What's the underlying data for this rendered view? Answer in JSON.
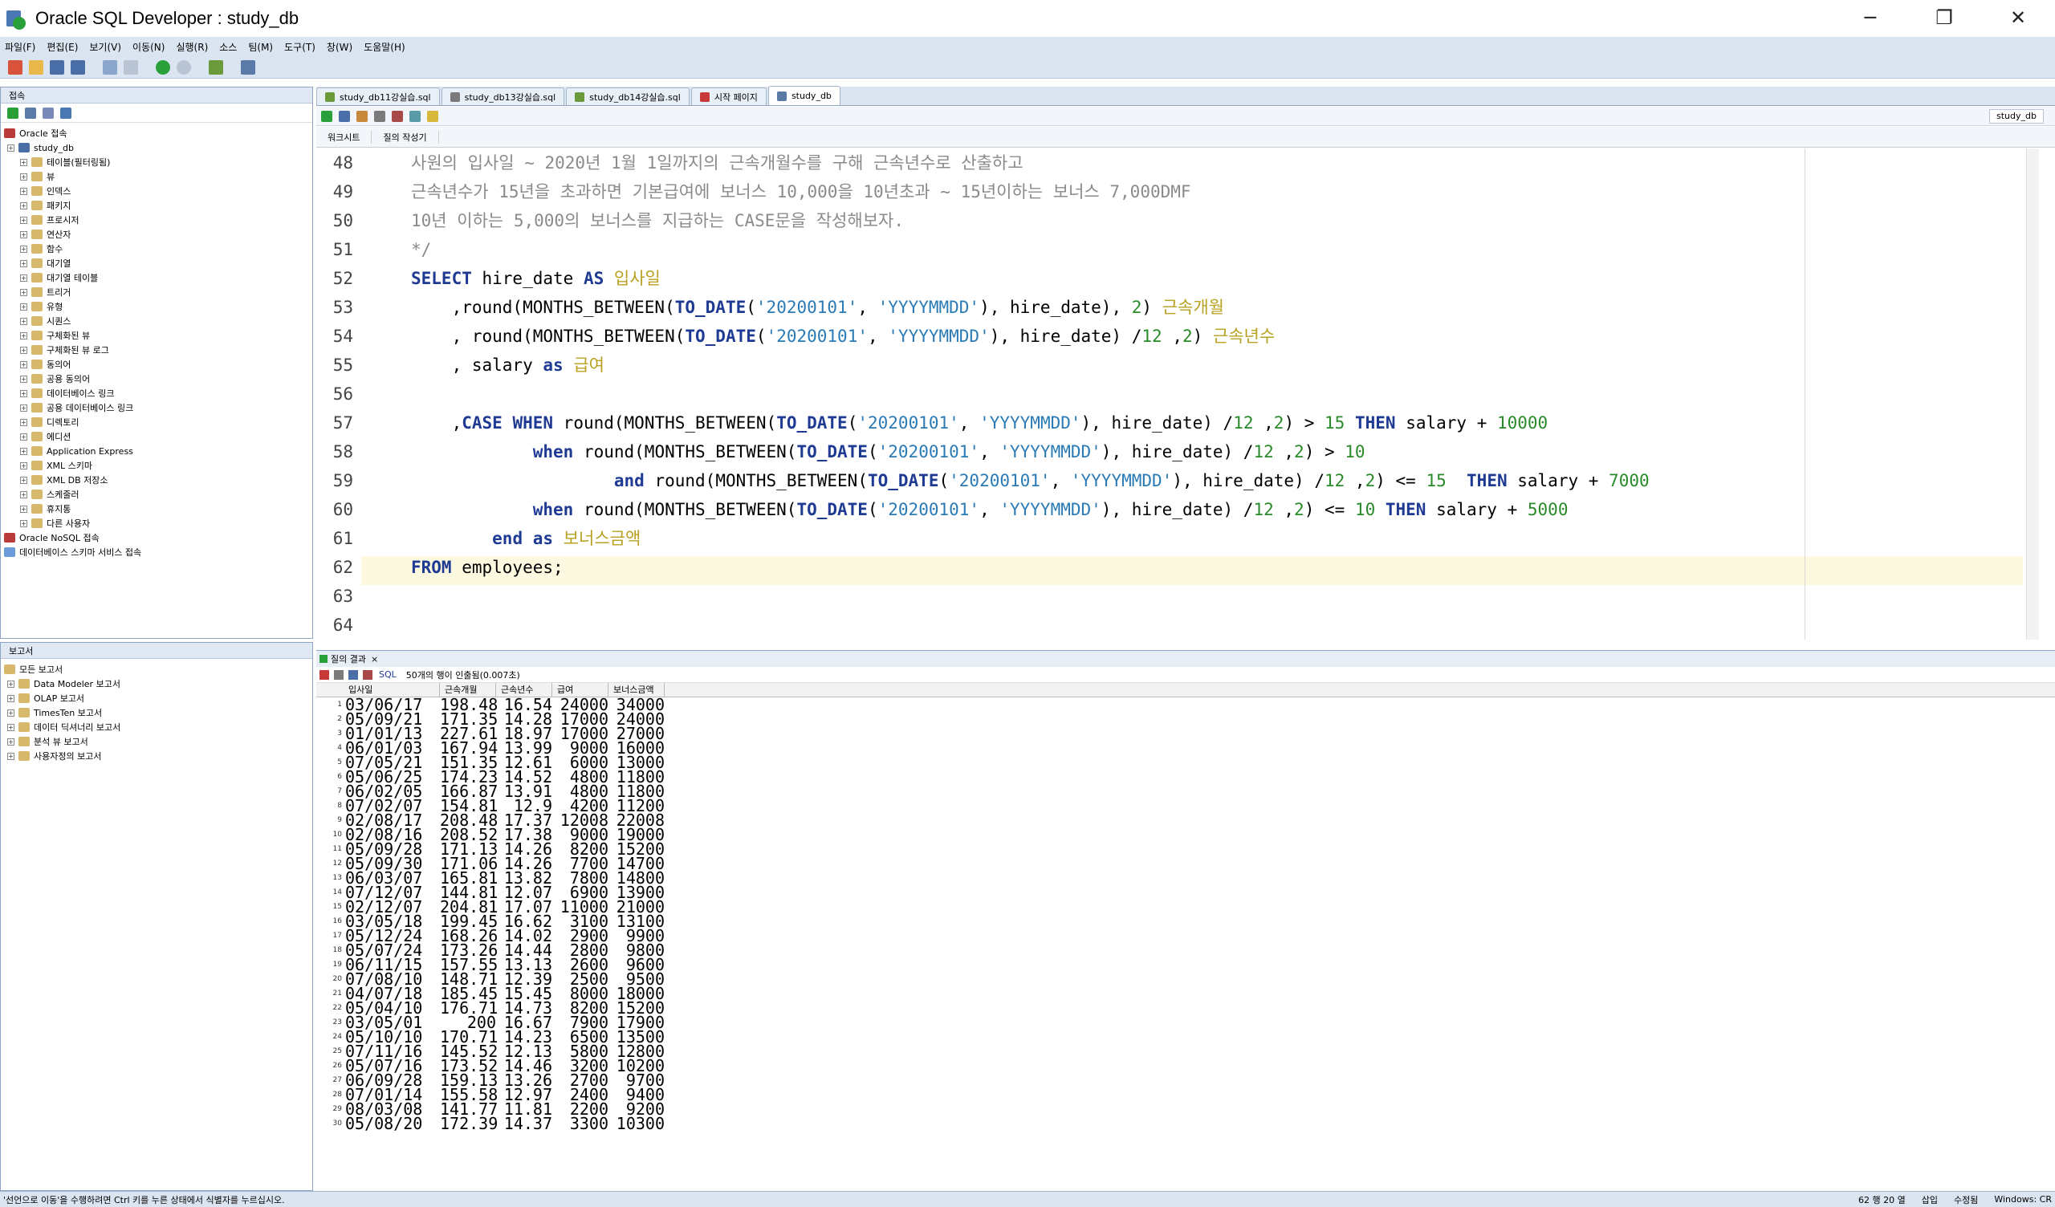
{
  "window": {
    "title": "Oracle SQL Developer : study_db",
    "minimize": "─",
    "maximize": "❐",
    "close": "✕"
  },
  "menu": [
    "파일(F)",
    "편집(E)",
    "보기(V)",
    "이동(N)",
    "실행(R)",
    "소스",
    "팀(M)",
    "도구(T)",
    "창(W)",
    "도움말(H)"
  ],
  "connections": {
    "header": "접속",
    "oracle_label": "Oracle 접속",
    "db_label": "study_db",
    "items": [
      "테이블(필터링됨)",
      "뷰",
      "인덱스",
      "패키지",
      "프로시저",
      "연산자",
      "함수",
      "대기열",
      "대기열 테이블",
      "트리거",
      "유형",
      "시퀀스",
      "구체화된 뷰",
      "구체화된 뷰 로그",
      "동의어",
      "공용 동의어",
      "데이터베이스 링크",
      "공용 데이터베이스 링크",
      "디렉토리",
      "에디션",
      "Application Express",
      "XML 스키마",
      "XML DB 저장소",
      "스케줄러",
      "휴지통",
      "다른 사용자"
    ],
    "nosql_label": "Oracle NoSQL 접속",
    "cloud_label": "데이터베이스 스키마 서비스 접속"
  },
  "reports": {
    "header": "보고서",
    "items": [
      "모든 보고서",
      "Data Modeler 보고서",
      "OLAP 보고서",
      "TimesTen 보고서",
      "데이터 딕셔너리 보고서",
      "분석 뷰 보고서",
      "사용자정의 보고서"
    ]
  },
  "editor_tabs": [
    "study_db11강실습.sql",
    "study_db13강실습.sql",
    "study_db14강실습.sql",
    "시작 페이지",
    "study_db"
  ],
  "connection_selector": "study_db",
  "sub_tabs": [
    "워크시트",
    "질의 작성기"
  ],
  "code_lines": [
    {
      "n": "48",
      "html": "<span class='cm'>사원의 입사일 ~ 2020년 1월 1일까지의 근속개월수를 구해 근속년수로 산출하고</span>"
    },
    {
      "n": "49",
      "html": "<span class='cm'>근속년수가 15년을 초과하면 기본급여에 보너스 10,000을 10년초과 ~ 15년이하는 보너스 7,000DMF</span>"
    },
    {
      "n": "50",
      "html": "<span class='cm'>10년 이하는 5,000의 보너스를 지급하는 CASE문을 작성해보자.</span>"
    },
    {
      "n": "51",
      "html": "<span class='cm'>*/</span>"
    },
    {
      "n": "52",
      "html": "<span class='kw'>SELECT</span> hire_date <span class='kw'>AS</span> <span class='al'>입사일</span>"
    },
    {
      "n": "53",
      "html": "    ,round(MONTHS_BETWEEN(<span class='kw'>TO_DATE</span>(<span class='str'>'20200101'</span>, <span class='str'>'YYYYMMDD'</span>), hire_date), <span class='num'>2</span>) <span class='al'>근속개월</span>"
    },
    {
      "n": "54",
      "html": "    , round(MONTHS_BETWEEN(<span class='kw'>TO_DATE</span>(<span class='str'>'20200101'</span>, <span class='str'>'YYYYMMDD'</span>), hire_date) /<span class='num'>12</span> ,<span class='num'>2</span>) <span class='al'>근속년수</span>"
    },
    {
      "n": "55",
      "html": "    , salary <span class='kw'>as</span> <span class='al'>급여</span>"
    },
    {
      "n": "56",
      "html": ""
    },
    {
      "n": "57",
      "html": "    ,<span class='kw'>CASE</span> <span class='kw'>WHEN</span> round(MONTHS_BETWEEN(<span class='kw'>TO_DATE</span>(<span class='str'>'20200101'</span>, <span class='str'>'YYYYMMDD'</span>), hire_date) /<span class='num'>12</span> ,<span class='num'>2</span>) > <span class='num'>15</span> <span class='kw'>THEN</span> salary + <span class='num'>10000</span>"
    },
    {
      "n": "58",
      "html": "            <span class='kw'>when</span> round(MONTHS_BETWEEN(<span class='kw'>TO_DATE</span>(<span class='str'>'20200101'</span>, <span class='str'>'YYYYMMDD'</span>), hire_date) /<span class='num'>12</span> ,<span class='num'>2</span>) > <span class='num'>10</span>"
    },
    {
      "n": "59",
      "html": "                    <span class='kw'>and</span> round(MONTHS_BETWEEN(<span class='kw'>TO_DATE</span>(<span class='str'>'20200101'</span>, <span class='str'>'YYYYMMDD'</span>), hire_date) /<span class='num'>12</span> ,<span class='num'>2</span>) <= <span class='num'>15</span>  <span class='kw'>THEN</span> salary + <span class='num'>7000</span>"
    },
    {
      "n": "60",
      "html": "            <span class='kw'>when</span> round(MONTHS_BETWEEN(<span class='kw'>TO_DATE</span>(<span class='str'>'20200101'</span>, <span class='str'>'YYYYMMDD'</span>), hire_date) /<span class='num'>12</span> ,<span class='num'>2</span>) <= <span class='num'>10</span> <span class='kw'>THEN</span> salary + <span class='num'>5000</span>"
    },
    {
      "n": "61",
      "html": "        <span class='kw'>end</span> <span class='kw'>as</span> <span class='al'>보너스금액</span>"
    },
    {
      "n": "62",
      "html": "<span class='kw'>FROM</span> employees;"
    },
    {
      "n": "63",
      "html": ""
    },
    {
      "n": "64",
      "html": ""
    }
  ],
  "results": {
    "tab_label": "질의 결과",
    "close": "×",
    "sql_label": "SQL",
    "fetch_info": "50개의 행이 인출됨(0.007초)",
    "columns": [
      "입사일",
      "근속개월",
      "근속년수",
      "급여",
      "보너스금액"
    ],
    "rows": [
      [
        "03/06/17",
        "198.48",
        "16.54",
        "24000",
        "34000"
      ],
      [
        "05/09/21",
        "171.35",
        "14.28",
        "17000",
        "24000"
      ],
      [
        "01/01/13",
        "227.61",
        "18.97",
        "17000",
        "27000"
      ],
      [
        "06/01/03",
        "167.94",
        "13.99",
        "9000",
        "16000"
      ],
      [
        "07/05/21",
        "151.35",
        "12.61",
        "6000",
        "13000"
      ],
      [
        "05/06/25",
        "174.23",
        "14.52",
        "4800",
        "11800"
      ],
      [
        "06/02/05",
        "166.87",
        "13.91",
        "4800",
        "11800"
      ],
      [
        "07/02/07",
        "154.81",
        "12.9",
        "4200",
        "11200"
      ],
      [
        "02/08/17",
        "208.48",
        "17.37",
        "12008",
        "22008"
      ],
      [
        "02/08/16",
        "208.52",
        "17.38",
        "9000",
        "19000"
      ],
      [
        "05/09/28",
        "171.13",
        "14.26",
        "8200",
        "15200"
      ],
      [
        "05/09/30",
        "171.06",
        "14.26",
        "7700",
        "14700"
      ],
      [
        "06/03/07",
        "165.81",
        "13.82",
        "7800",
        "14800"
      ],
      [
        "07/12/07",
        "144.81",
        "12.07",
        "6900",
        "13900"
      ],
      [
        "02/12/07",
        "204.81",
        "17.07",
        "11000",
        "21000"
      ],
      [
        "03/05/18",
        "199.45",
        "16.62",
        "3100",
        "13100"
      ],
      [
        "05/12/24",
        "168.26",
        "14.02",
        "2900",
        "9900"
      ],
      [
        "05/07/24",
        "173.26",
        "14.44",
        "2800",
        "9800"
      ],
      [
        "06/11/15",
        "157.55",
        "13.13",
        "2600",
        "9600"
      ],
      [
        "07/08/10",
        "148.71",
        "12.39",
        "2500",
        "9500"
      ],
      [
        "04/07/18",
        "185.45",
        "15.45",
        "8000",
        "18000"
      ],
      [
        "05/04/10",
        "176.71",
        "14.73",
        "8200",
        "15200"
      ],
      [
        "03/05/01",
        "200",
        "16.67",
        "7900",
        "17900"
      ],
      [
        "05/10/10",
        "170.71",
        "14.23",
        "6500",
        "13500"
      ],
      [
        "07/11/16",
        "145.52",
        "12.13",
        "5800",
        "12800"
      ],
      [
        "05/07/16",
        "173.52",
        "14.46",
        "3200",
        "10200"
      ],
      [
        "06/09/28",
        "159.13",
        "13.26",
        "2700",
        "9700"
      ],
      [
        "07/01/14",
        "155.58",
        "12.97",
        "2400",
        "9400"
      ],
      [
        "08/03/08",
        "141.77",
        "11.81",
        "2200",
        "9200"
      ],
      [
        "05/08/20",
        "172.39",
        "14.37",
        "3300",
        "10300"
      ]
    ]
  },
  "status": {
    "left": "'선언으로 이동'을 수행하려면 Ctrl 키를 누른 상태에서 식별자를 누르십시오.",
    "position": "62 행 20 열",
    "mode": "삽입",
    "modified": "수정됨",
    "eol": "Windows: CR"
  }
}
